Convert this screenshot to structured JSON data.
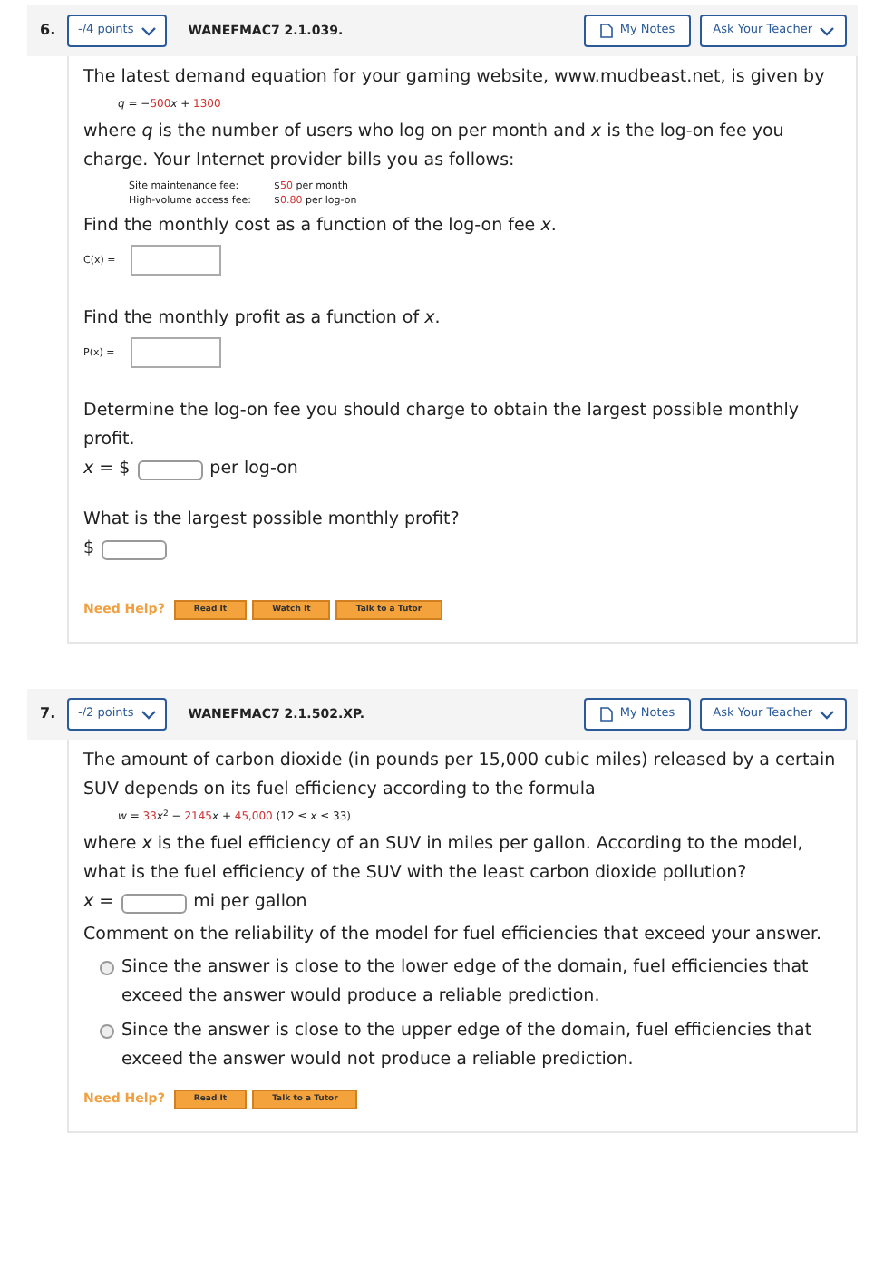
{
  "questions": [
    {
      "number": "6.",
      "points": "-/4 points",
      "code": "WANEFMAC7 2.1.039.",
      "notes_button": "My Notes",
      "ask_button": "Ask Your Teacher",
      "parts": [
        {
          "kind": "paragraph",
          "text": "The latest demand equation for your gaming website, www.mudbeast.net, is given by"
        },
        {
          "kind": "equation",
          "segments": [
            {
              "text": "*q* = −",
              "red": false
            },
            {
              "text": "500",
              "red": true
            },
            {
              "text": "*x* + ",
              "red": false
            },
            {
              "text": "1300",
              "red": true
            }
          ]
        },
        {
          "kind": "paragraph",
          "text": "where *q* is the number of users who log on per month and *x* is the log-on fee you charge. Your Internet provider bills you as follows:"
        },
        {
          "kind": "fee_table",
          "rows": [
            {
              "label": "Site maintenance fee:",
              "segments": [
                {
                  "text": "$",
                  "red": false
                },
                {
                  "text": "50",
                  "red": true
                },
                {
                  "text": " per month",
                  "red": false
                }
              ]
            },
            {
              "label": "High-volume access fee:",
              "segments": [
                {
                  "text": "$",
                  "red": false
                },
                {
                  "text": "0.80",
                  "red": true
                },
                {
                  "text": " per log-on",
                  "red": false
                }
              ]
            }
          ]
        },
        {
          "kind": "paragraph",
          "text": "Find the monthly cost as a function of the log-on fee *x*."
        },
        {
          "kind": "function_answer",
          "label": "C(x) ="
        },
        {
          "kind": "paragraph",
          "text": "Find the monthly profit as a function of *x*."
        },
        {
          "kind": "function_answer",
          "label": "P(x) ="
        },
        {
          "kind": "paragraph",
          "text": "Determine the log-on fee you should charge to obtain the largest possible monthly profit."
        },
        {
          "kind": "inline_answer",
          "before": "*x* = $",
          "after": "per log-on"
        },
        {
          "kind": "paragraph",
          "text": "What is the largest possible monthly profit?"
        },
        {
          "kind": "inline_answer",
          "before": "$"
        }
      ],
      "help_label": "Need Help?",
      "help_buttons": [
        "Read It",
        "Watch It",
        "Talk to a Tutor"
      ]
    },
    {
      "number": "7.",
      "points": "-/2 points",
      "code": "WANEFMAC7 2.1.502.XP.",
      "notes_button": "My Notes",
      "ask_button": "Ask Your Teacher",
      "parts": [
        {
          "kind": "paragraph",
          "text": "The amount of carbon dioxide (in pounds per 15,000 cubic miles) released by a certain SUV depends on its fuel efficiency according to the formula"
        },
        {
          "kind": "equation",
          "segments": [
            {
              "text": "*w* = ",
              "red": false
            },
            {
              "text": "33",
              "red": true
            },
            {
              "text": "*x*$^{2}$ − ",
              "red": false
            },
            {
              "text": "2145",
              "red": true
            },
            {
              "text": "*x* + ",
              "red": false
            },
            {
              "text": "45,000",
              "red": true
            },
            {
              "text": "      (12 ≤ *x* ≤ 33)",
              "red": false
            }
          ]
        },
        {
          "kind": "paragraph",
          "text": "where *x* is the fuel efficiency of an SUV in miles per gallon. According to the model, what is the fuel efficiency of the SUV with the least carbon dioxide pollution?"
        },
        {
          "kind": "inline_answer",
          "before": "*x* =",
          "after": "mi per gallon"
        },
        {
          "kind": "paragraph",
          "text": "Comment on the reliability of the model for fuel efficiencies that exceed your answer."
        },
        {
          "kind": "radio_group",
          "options": [
            {
              "text": "Since the answer is close to the lower edge of the domain, fuel efficiencies that exceed the answer would produce a reliable prediction.",
              "selected": false
            },
            {
              "text": "Since the answer is close to the upper edge of the domain, fuel efficiencies that exceed the answer would not produce a reliable prediction.",
              "selected": false
            }
          ]
        }
      ],
      "help_label": "Need Help?",
      "help_buttons": [
        "Read It",
        "Talk to a Tutor"
      ]
    }
  ]
}
